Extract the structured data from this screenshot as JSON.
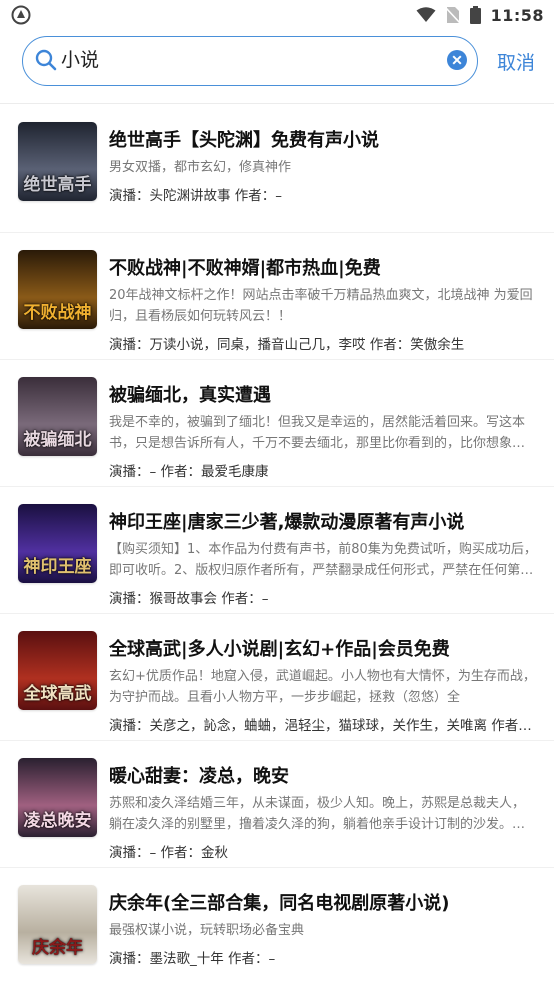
{
  "status_bar": {
    "time": "11:58"
  },
  "search": {
    "query": "小说",
    "cancel_label": "取消"
  },
  "results": [
    {
      "title": "绝世高手【头陀渊】免费有声小说",
      "desc": "男女双播，都市玄幻，修真神作",
      "meta": "演播：头陀渊讲故事    作者：–",
      "cover_text": "绝世高手",
      "cover_colors": [
        "#1f2430",
        "#5a6175",
        "#c8c8d0"
      ]
    },
    {
      "title": "不败战神|不败神婿|都市热血|免费",
      "desc": "20年战神文标杆之作！网站点击率破千万精品热血爽文，北境战神 为爱回归，且看杨辰如何玩转风云！！",
      "meta": "演播：万读小说，同桌，播音山己几，李哎    作者：笑傲余生",
      "cover_text": "不败战神",
      "cover_colors": [
        "#2a1a08",
        "#8a5a18",
        "#f0b030"
      ]
    },
    {
      "title": "被骗缅北，真实遭遇",
      "desc": "我是不幸的，被骗到了缅北！但我又是幸运的，居然能活着回来。写这本书，只是想告诉所有人，千万不要去缅北，那里比你看到的，比你想象的，还要…",
      "meta": "演播：–    作者：最爱毛康康",
      "cover_text": "被骗缅北",
      "cover_colors": [
        "#3a2e3a",
        "#7a6a7a",
        "#e8d8e0"
      ]
    },
    {
      "title": "神印王座|唐家三少著,爆款动漫原著有声小说",
      "desc": "【购买须知】1、本作品为付费有声书，前80集为免费试听，购买成功后，即可收听。2、版权归原作者所有，严禁翻录成任何形式，严禁在任何第三方平台传…",
      "meta": "演播：猴哥故事会    作者：–",
      "cover_text": "神印王座",
      "cover_colors": [
        "#1a1040",
        "#5030a0",
        "#e0c070"
      ]
    },
    {
      "title": "全球高武|多人小说剧|玄幻+作品|会员免费",
      "desc": "玄幻+优质作品！地窟入侵，武道崛起。小人物也有大情怀，为生存而战，为守护而战。且看小人物方平，一步步崛起，拯救（忽悠）全",
      "meta": "演播：关彦之，訫念，蛐蛐，浥轻尘，猫球球，关作生，关唯离    作者：…",
      "cover_text": "全球高武",
      "cover_colors": [
        "#5a1010",
        "#b03020",
        "#f0e0c0"
      ]
    },
    {
      "title": "暖心甜妻：凌总，晚安",
      "desc": "苏熙和凌久泽结婚三年，从未谋面，极少人知。晚上，苏熙是总裁夫人，躺在凌久泽的别墅里，撸着凌久泽的狗，躺着他亲手设计订制的沙发。而到了白…",
      "meta": "演播：–    作者：金秋",
      "cover_text": "凌总晚安",
      "cover_colors": [
        "#2a2030",
        "#a06080",
        "#f4d8e4"
      ]
    },
    {
      "title": "庆余年(全三部合集，同名电视剧原著小说)",
      "desc": "最强权谋小说，玩转职场必备宝典",
      "meta": "演播：墨法歌_十年    作者：–",
      "cover_text": "庆余年",
      "cover_colors": [
        "#e8e4dc",
        "#b8b0a0",
        "#8a1a1a"
      ]
    }
  ]
}
